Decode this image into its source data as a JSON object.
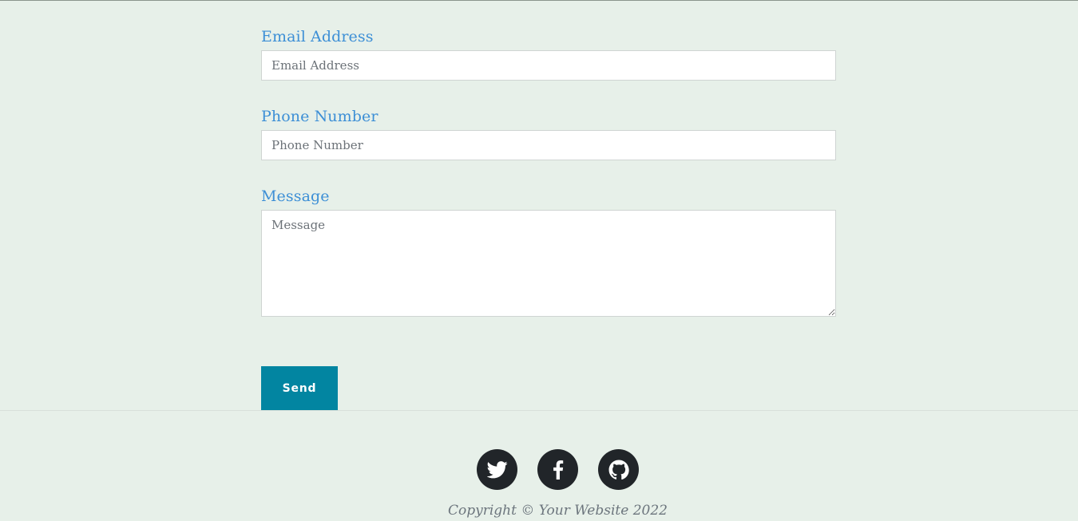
{
  "form": {
    "email": {
      "label": "Email Address",
      "placeholder": "Email Address"
    },
    "phone": {
      "label": "Phone Number",
      "placeholder": "Phone Number"
    },
    "message": {
      "label": "Message",
      "placeholder": "Message"
    },
    "send_label": "Send"
  },
  "footer": {
    "social": [
      {
        "icon": "twitter-icon"
      },
      {
        "icon": "facebook-icon"
      },
      {
        "icon": "github-icon"
      }
    ],
    "copyright": "Copyright © Your Website 2022"
  },
  "colors": {
    "background": "#e7f0e9",
    "label": "#3d8fd6",
    "button": "#0285a1",
    "social": "#212529"
  }
}
